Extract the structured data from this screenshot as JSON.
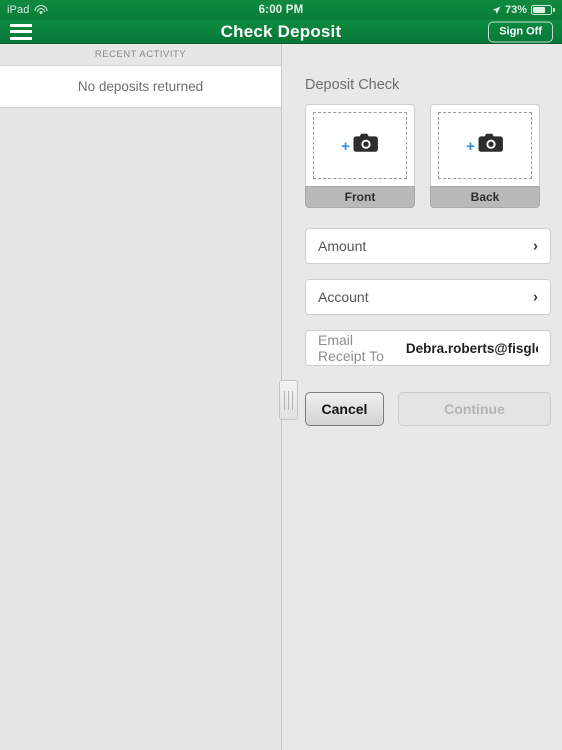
{
  "status_bar": {
    "device": "iPad",
    "wifi_icon": "wifi-icon",
    "time": "6:00 PM",
    "location_icon": "location-arrow-icon",
    "battery_percent": "73%",
    "battery_level": 73
  },
  "nav_bar": {
    "menu_icon": "hamburger-menu-icon",
    "title": "Check Deposit",
    "sign_off_label": "Sign Off"
  },
  "left_panel": {
    "section_header": "RECENT ACTIVITY",
    "empty_message": "No deposits returned"
  },
  "right_panel": {
    "title": "Deposit Check",
    "captures": [
      {
        "label": "Front",
        "plus": "+",
        "camera_icon": "camera-icon"
      },
      {
        "label": "Back",
        "plus": "+",
        "camera_icon": "camera-icon"
      }
    ],
    "fields": [
      {
        "label": "Amount",
        "chevron": "›"
      },
      {
        "label": "Account",
        "chevron": "›"
      }
    ],
    "email_row": {
      "label": "Email Receipt To",
      "value": "Debra.roberts@fisgloba…"
    },
    "buttons": {
      "cancel": "Cancel",
      "continue": "Continue"
    }
  },
  "colors": {
    "brand_green": "#0c8b3e",
    "accent_blue": "#2f8fe0",
    "panel_gray": "#e8e8e8"
  }
}
